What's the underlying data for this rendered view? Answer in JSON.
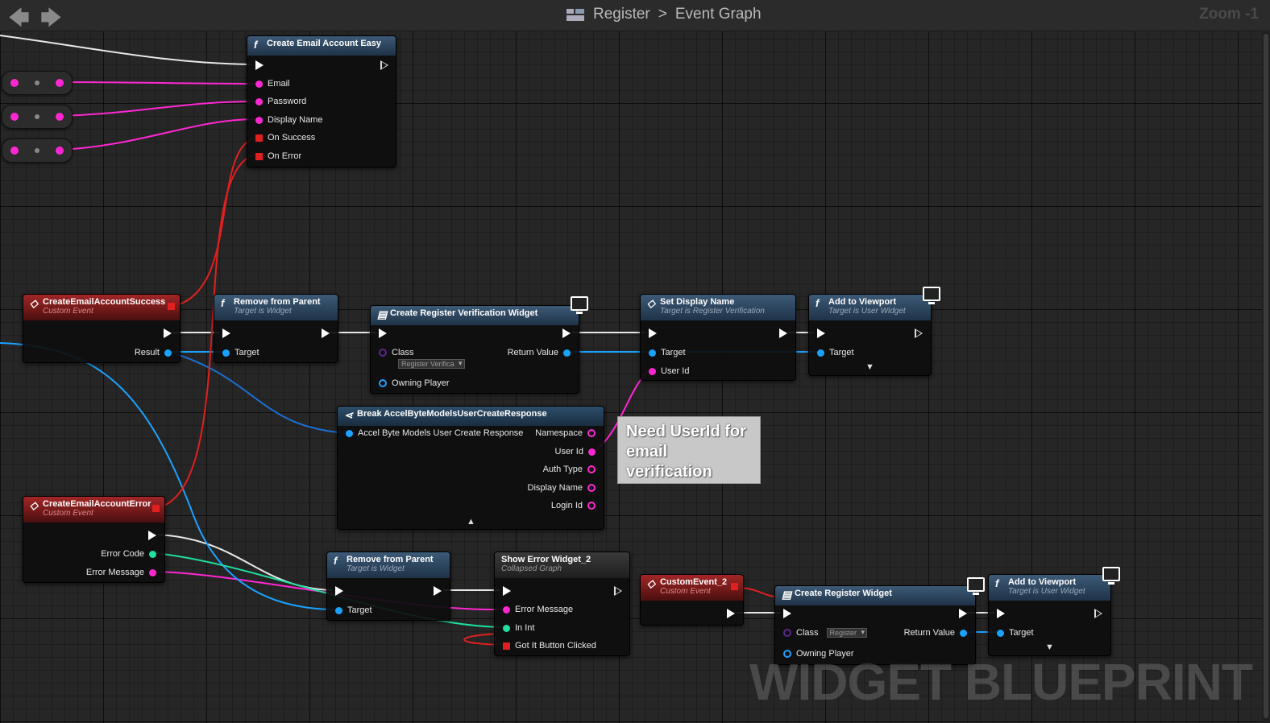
{
  "topbar": {
    "back_icon": "left-arrow-icon",
    "forward_icon": "right-arrow-icon",
    "breadcrumb_root": "Register",
    "breadcrumb_separator": ">",
    "breadcrumb_current": "Event Graph",
    "zoom": "Zoom -1"
  },
  "nodes": {
    "create_email": {
      "title": "Create Email Account Easy",
      "pins": {
        "email": "Email",
        "password": "Password",
        "display_name": "Display Name",
        "on_success": "On Success",
        "on_error": "On Error"
      }
    },
    "success_event": {
      "title": "CreateEmailAccountSuccess",
      "subtitle": "Custom Event",
      "result": "Result"
    },
    "remove_parent_1": {
      "title": "Remove from Parent",
      "subtitle": "Target is Widget",
      "target": "Target"
    },
    "create_reg_verif": {
      "title": "Create Register Verification Widget",
      "class_label": "Class",
      "class_value": "Register Verifica",
      "return_value": "Return Value",
      "owning_player": "Owning Player"
    },
    "set_display_name": {
      "title": "Set Display Name",
      "subtitle": "Target is Register Verification",
      "target": "Target",
      "user_id": "User Id"
    },
    "add_viewport_1": {
      "title": "Add to Viewport",
      "subtitle": "Target is User Widget",
      "target": "Target"
    },
    "break_response": {
      "title": "Break AccelByteModelsUserCreateResponse",
      "input": "Accel Byte Models User Create Response",
      "outputs": [
        "Namespace",
        "User Id",
        "Auth Type",
        "Display Name",
        "Login Id"
      ]
    },
    "error_event": {
      "title": "CreateEmailAccountError",
      "subtitle": "Custom Event",
      "error_code": "Error Code",
      "error_message": "Error Message"
    },
    "remove_parent_2": {
      "title": "Remove from Parent",
      "subtitle": "Target is Widget",
      "target": "Target"
    },
    "show_error": {
      "title": "Show Error Widget_2",
      "subtitle": "Collapsed Graph",
      "error_message": "Error Message",
      "in_int": "In Int",
      "got_it": "Got It Button Clicked"
    },
    "custom_event_2": {
      "title": "CustomEvent_2",
      "subtitle": "Custom Event"
    },
    "create_register": {
      "title": "Create Register Widget",
      "class_label": "Class",
      "class_value": "Register",
      "return_value": "Return Value",
      "owning_player": "Owning Player"
    },
    "add_viewport_2": {
      "title": "Add to Viewport",
      "subtitle": "Target is User Widget",
      "target": "Target"
    }
  },
  "comment": "Need UserId for email verification",
  "watermark": "WIDGET BLUEPRINT",
  "colors": {
    "string_pin": "#ff27d2",
    "object_pin": "#1aa2ff",
    "int_pin": "#1fe0a0",
    "delegate_pin": "#e02020",
    "event_header": "#a32626",
    "function_header": "#3c5a77",
    "graph_background": "#262626"
  }
}
